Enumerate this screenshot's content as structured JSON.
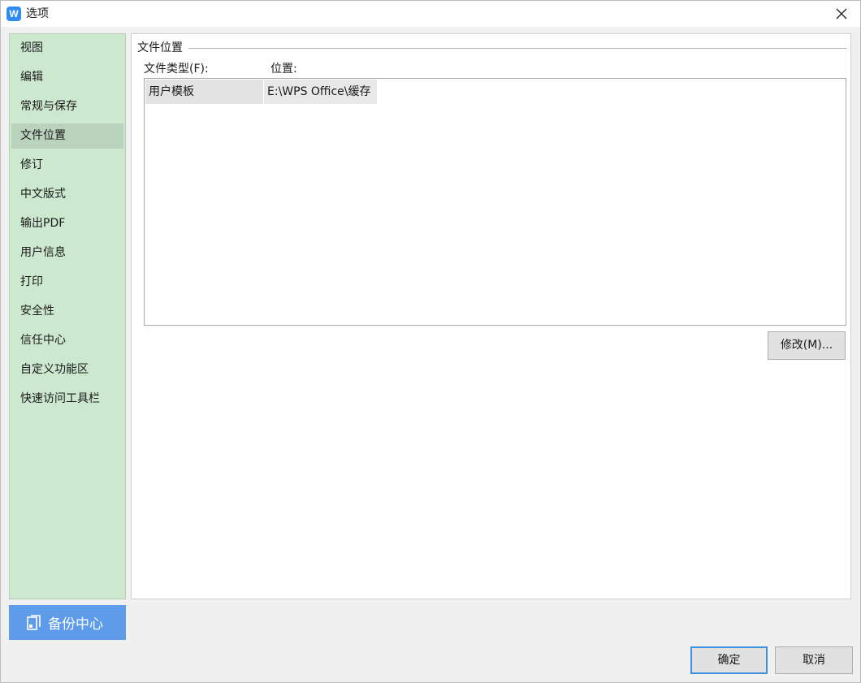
{
  "window": {
    "title": "选项",
    "app_icon_letter": "W"
  },
  "sidebar": {
    "items": [
      {
        "label": "视图"
      },
      {
        "label": "编辑"
      },
      {
        "label": "常规与保存"
      },
      {
        "label": "文件位置",
        "active": true
      },
      {
        "label": "修订"
      },
      {
        "label": "中文版式"
      },
      {
        "label": "输出PDF"
      },
      {
        "label": "用户信息"
      },
      {
        "label": "打印"
      },
      {
        "label": "安全性"
      },
      {
        "label": "信任中心"
      },
      {
        "label": "自定义功能区"
      },
      {
        "label": "快速访问工具栏"
      }
    ],
    "backup_label": "备份中心"
  },
  "main": {
    "group_title": "文件位置",
    "col_type": "文件类型(F):",
    "col_location": "位置:",
    "rows": [
      {
        "type": "用户模板",
        "path": "E:\\WPS Office\\缓存"
      }
    ],
    "modify_label": "修改(M)..."
  },
  "footer": {
    "ok_label": "确定",
    "cancel_label": "取消"
  },
  "colors": {
    "sidebar_bg": "#cce8cf",
    "sidebar_active": "#b9d3bc",
    "backup_bg": "#5e9be9",
    "ok_border": "#3d8fe0"
  }
}
